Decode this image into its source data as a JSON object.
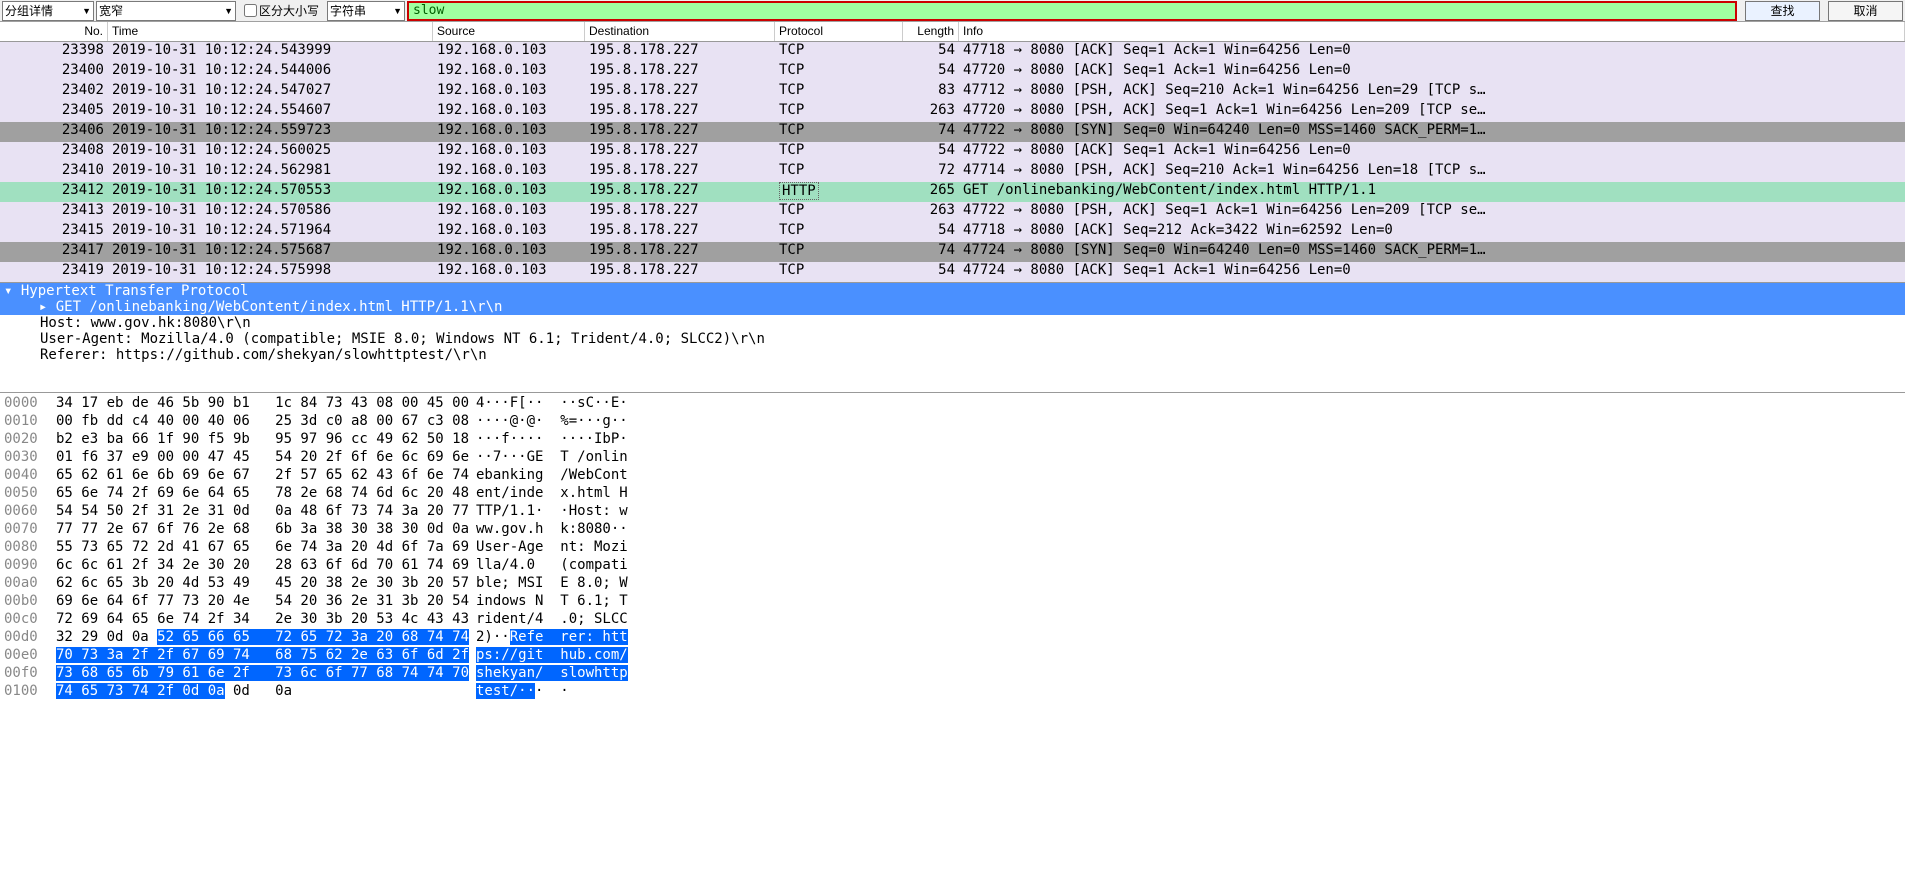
{
  "toolbar": {
    "combo1": "分组详情",
    "combo2": "宽窄",
    "case_label": "区分大小写",
    "combo3": "字符串",
    "search_value": "slow",
    "find_label": "查找",
    "cancel_label": "取消"
  },
  "columns": [
    "No.",
    "Time",
    "Source",
    "Destination",
    "Protocol",
    "Length",
    "Info"
  ],
  "rows": [
    {
      "no": "23398",
      "time": "2019-10-31 10:12:24.543999",
      "src": "192.168.0.103",
      "dst": "195.8.178.227",
      "proto": "TCP",
      "len": "54",
      "info": "47718 → 8080 [ACK] Seq=1 Ack=1 Win=64256 Len=0",
      "cls": "row-lavender"
    },
    {
      "no": "23400",
      "time": "2019-10-31 10:12:24.544006",
      "src": "192.168.0.103",
      "dst": "195.8.178.227",
      "proto": "TCP",
      "len": "54",
      "info": "47720 → 8080 [ACK] Seq=1 Ack=1 Win=64256 Len=0",
      "cls": "row-lavender"
    },
    {
      "no": "23402",
      "time": "2019-10-31 10:12:24.547027",
      "src": "192.168.0.103",
      "dst": "195.8.178.227",
      "proto": "TCP",
      "len": "83",
      "info": "47712 → 8080 [PSH, ACK] Seq=210 Ack=1 Win=64256 Len=29 [TCP s…",
      "cls": "row-lavender"
    },
    {
      "no": "23405",
      "time": "2019-10-31 10:12:24.554607",
      "src": "192.168.0.103",
      "dst": "195.8.178.227",
      "proto": "TCP",
      "len": "263",
      "info": "47720 → 8080 [PSH, ACK] Seq=1 Ack=1 Win=64256 Len=209 [TCP se…",
      "cls": "row-lavender"
    },
    {
      "no": "23406",
      "time": "2019-10-31 10:12:24.559723",
      "src": "192.168.0.103",
      "dst": "195.8.178.227",
      "proto": "TCP",
      "len": "74",
      "info": "47722 → 8080 [SYN] Seq=0 Win=64240 Len=0 MSS=1460 SACK_PERM=1…",
      "cls": "row-gray"
    },
    {
      "no": "23408",
      "time": "2019-10-31 10:12:24.560025",
      "src": "192.168.0.103",
      "dst": "195.8.178.227",
      "proto": "TCP",
      "len": "54",
      "info": "47722 → 8080 [ACK] Seq=1 Ack=1 Win=64256 Len=0",
      "cls": "row-lavender"
    },
    {
      "no": "23410",
      "time": "2019-10-31 10:12:24.562981",
      "src": "192.168.0.103",
      "dst": "195.8.178.227",
      "proto": "TCP",
      "len": "72",
      "info": "47714 → 8080 [PSH, ACK] Seq=210 Ack=1 Win=64256 Len=18 [TCP s…",
      "cls": "row-lavender"
    },
    {
      "no": "23412",
      "time": "2019-10-31 10:12:24.570553",
      "src": "192.168.0.103",
      "dst": "195.8.178.227",
      "proto": "HTTP",
      "len": "265",
      "info": "GET  /onlinebanking/WebContent/index.html HTTP/1.1",
      "cls": "row-sel"
    },
    {
      "no": "23413",
      "time": "2019-10-31 10:12:24.570586",
      "src": "192.168.0.103",
      "dst": "195.8.178.227",
      "proto": "TCP",
      "len": "263",
      "info": "47722 → 8080 [PSH, ACK] Seq=1 Ack=1 Win=64256 Len=209 [TCP se…",
      "cls": "row-lavender"
    },
    {
      "no": "23415",
      "time": "2019-10-31 10:12:24.571964",
      "src": "192.168.0.103",
      "dst": "195.8.178.227",
      "proto": "TCP",
      "len": "54",
      "info": "47718 → 8080 [ACK] Seq=212 Ack=3422 Win=62592 Len=0",
      "cls": "row-lavender"
    },
    {
      "no": "23417",
      "time": "2019-10-31 10:12:24.575687",
      "src": "192.168.0.103",
      "dst": "195.8.178.227",
      "proto": "TCP",
      "len": "74",
      "info": "47724 → 8080 [SYN] Seq=0 Win=64240 Len=0 MSS=1460 SACK_PERM=1…",
      "cls": "row-gray"
    },
    {
      "no": "23419",
      "time": "2019-10-31 10:12:24.575998",
      "src": "192.168.0.103",
      "dst": "195.8.178.227",
      "proto": "TCP",
      "len": "54",
      "info": "47724 → 8080 [ACK] Seq=1 Ack=1 Win=64256 Len=0",
      "cls": "row-lavender"
    }
  ],
  "details": {
    "l0": "Hypertext Transfer Protocol",
    "l1": "GET /onlinebanking/WebContent/index.html HTTP/1.1\\r\\n",
    "l2": "Host: www.gov.hk:8080\\r\\n",
    "l3": "User-Agent: Mozilla/4.0 (compatible; MSIE 8.0; Windows NT 6.1; Trident/4.0; SLCC2)\\r\\n",
    "l4": "Referer: https://github.com/shekyan/slowhttptest/\\r\\n"
  },
  "hex": [
    {
      "off": "0000",
      "b": "34 17 eb de 46 5b 90 b1   1c 84 73 43 08 00 45 00",
      "a": "4···F[··  ··sC··E·"
    },
    {
      "off": "0010",
      "b": "00 fb dd c4 40 00 40 06   25 3d c0 a8 00 67 c3 08",
      "a": "····@·@·  %=···g··"
    },
    {
      "off": "0020",
      "b": "b2 e3 ba 66 1f 90 f5 9b   95 97 96 cc 49 62 50 18",
      "a": "···f····  ····IbP·"
    },
    {
      "off": "0030",
      "b": "01 f6 37 e9 00 00 47 45   54 20 2f 6f 6e 6c 69 6e",
      "a": "··7···GE  T /onlin"
    },
    {
      "off": "0040",
      "b": "65 62 61 6e 6b 69 6e 67   2f 57 65 62 43 6f 6e 74",
      "a": "ebanking  /WebCont"
    },
    {
      "off": "0050",
      "b": "65 6e 74 2f 69 6e 64 65   78 2e 68 74 6d 6c 20 48",
      "a": "ent/inde  x.html H"
    },
    {
      "off": "0060",
      "b": "54 54 50 2f 31 2e 31 0d   0a 48 6f 73 74 3a 20 77",
      "a": "TTP/1.1·  ·Host: w"
    },
    {
      "off": "0070",
      "b": "77 77 2e 67 6f 76 2e 68   6b 3a 38 30 38 30 0d 0a",
      "a": "ww.gov.h  k:8080··"
    },
    {
      "off": "0080",
      "b": "55 73 65 72 2d 41 67 65   6e 74 3a 20 4d 6f 7a 69",
      "a": "User-Age  nt: Mozi"
    },
    {
      "off": "0090",
      "b": "6c 6c 61 2f 34 2e 30 20   28 63 6f 6d 70 61 74 69",
      "a": "lla/4.0   (compati"
    },
    {
      "off": "00a0",
      "b": "62 6c 65 3b 20 4d 53 49   45 20 38 2e 30 3b 20 57",
      "a": "ble; MSI  E 8.0; W"
    },
    {
      "off": "00b0",
      "b": "69 6e 64 6f 77 73 20 4e   54 20 36 2e 31 3b 20 54",
      "a": "indows N  T 6.1; T"
    },
    {
      "off": "00c0",
      "b": "72 69 64 65 6e 74 2f 34   2e 30 3b 20 53 4c 43 43",
      "a": "rident/4  .0; SLCC"
    },
    {
      "off": "00d0",
      "b1": "32 29 0d 0a ",
      "b2": "52 65 66 65   72 65 72 3a 20 68 74 74",
      "a1": "2)··",
      "a2": "Refe  rer: htt"
    },
    {
      "off": "00e0",
      "b2": "70 73 3a 2f 2f 67 69 74   68 75 62 2e 63 6f 6d 2f",
      "a2": "ps://git  hub.com/"
    },
    {
      "off": "00f0",
      "b2": "73 68 65 6b 79 61 6e 2f   73 6c 6f 77 68 74 74 70",
      "a2": "shekyan/  slowhttp"
    },
    {
      "off": "0100",
      "b2": "74 65 73 74 2f 0d 0a",
      "b3": " 0d   0a",
      "a2": "test/··",
      "a3": "·  ·"
    }
  ]
}
